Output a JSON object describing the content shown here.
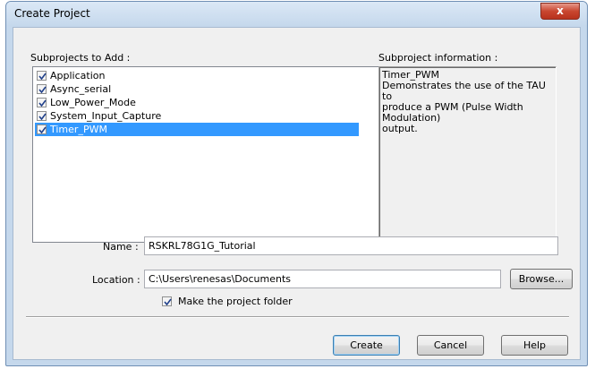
{
  "window": {
    "title": "Create Project",
    "close_glyph": "x"
  },
  "subprojects": {
    "heading": "Subprojects to Add :",
    "items": [
      {
        "label": "Application",
        "checked": true,
        "selected": false
      },
      {
        "label": "Async_serial",
        "checked": true,
        "selected": false
      },
      {
        "label": "Low_Power_Mode",
        "checked": true,
        "selected": false
      },
      {
        "label": "System_Input_Capture",
        "checked": true,
        "selected": false
      },
      {
        "label": "Timer_PWM",
        "checked": true,
        "selected": true
      }
    ]
  },
  "info": {
    "heading": "Subproject information :",
    "lines": [
      "Timer_PWM",
      "Demonstrates the use of the TAU to",
      "produce a PWM (Pulse Width Modulation)",
      "output."
    ]
  },
  "name": {
    "label": "Name :",
    "value": "RSKRL78G1G_Tutorial"
  },
  "location": {
    "label": "Location :",
    "value": "C:\\Users\\renesas\\Documents",
    "browse_label": "Browse..."
  },
  "make_folder": {
    "label": "Make the project folder",
    "checked": true
  },
  "buttons": {
    "create": "Create",
    "cancel": "Cancel",
    "help": "Help"
  },
  "colors": {
    "selection": "#3399ff",
    "close_button": "#c9462f"
  }
}
